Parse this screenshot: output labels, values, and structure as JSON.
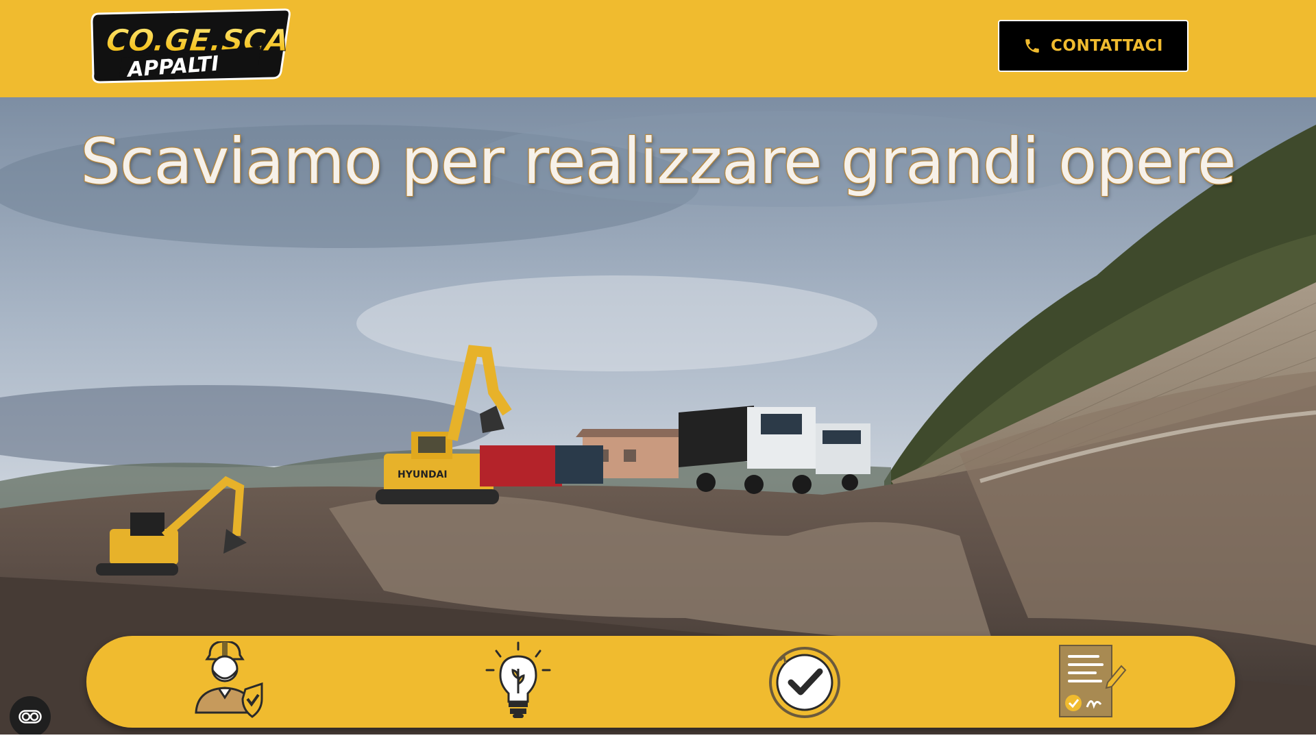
{
  "header": {
    "logo": {
      "line1": "CO.GE.SCA",
      "line2": "APPALTI"
    },
    "contact_button": {
      "label": "CONTATTACI",
      "icon": "phone-icon"
    }
  },
  "hero": {
    "title": "Scaviamo per realizzare grandi opere",
    "image": "construction-site-excavators-trucks",
    "excavator_brand": "HYUNDAI"
  },
  "features": [
    {
      "icon": "worker-safety-icon"
    },
    {
      "icon": "idea-lightbulb-icon"
    },
    {
      "icon": "quality-check-icon"
    },
    {
      "icon": "signed-contract-icon"
    }
  ],
  "accessibility_button": {
    "icon": "accessibility-toggle-icon"
  },
  "colors": {
    "brand_yellow": "#f0bb2f",
    "black": "#000000"
  }
}
